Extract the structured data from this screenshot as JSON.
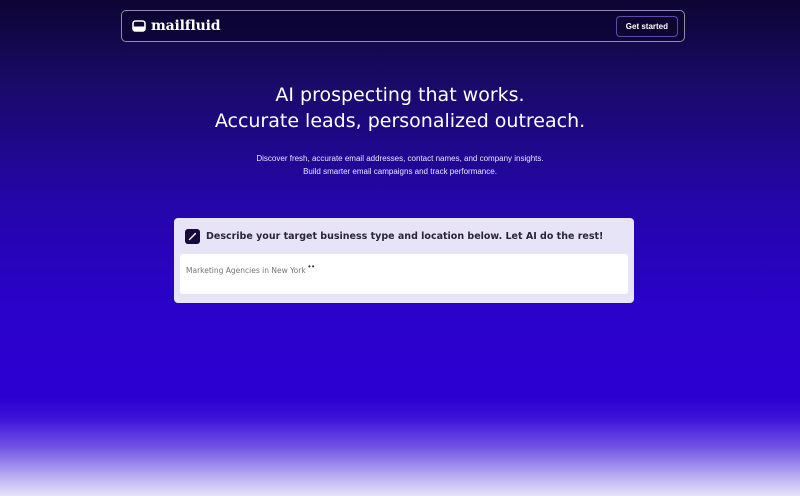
{
  "header": {
    "brand_name": "mailfluid",
    "brand_icon": "envelope-tray-icon",
    "cta_label": "Get started"
  },
  "hero": {
    "title_line1": "AI prospecting that works.",
    "title_line2": "Accurate leads, personalized outreach.",
    "subtitle_line1": "Discover fresh, accurate email addresses, contact names, and company insights.",
    "subtitle_line2": "Build smarter email campaigns and track performance."
  },
  "prompt": {
    "icon": "magic-wand-icon",
    "label": "Describe your target business type and location below. Let AI do the rest!",
    "placeholder": "Marketing Agencies in New York",
    "typing_indicator": "••"
  },
  "colors": {
    "background_top": "#0d0532",
    "background_mid": "#2d00d2",
    "background_bottom": "#e6e2fb",
    "card_bg": "#e8e4f7",
    "badge_bg": "#160a3c"
  }
}
